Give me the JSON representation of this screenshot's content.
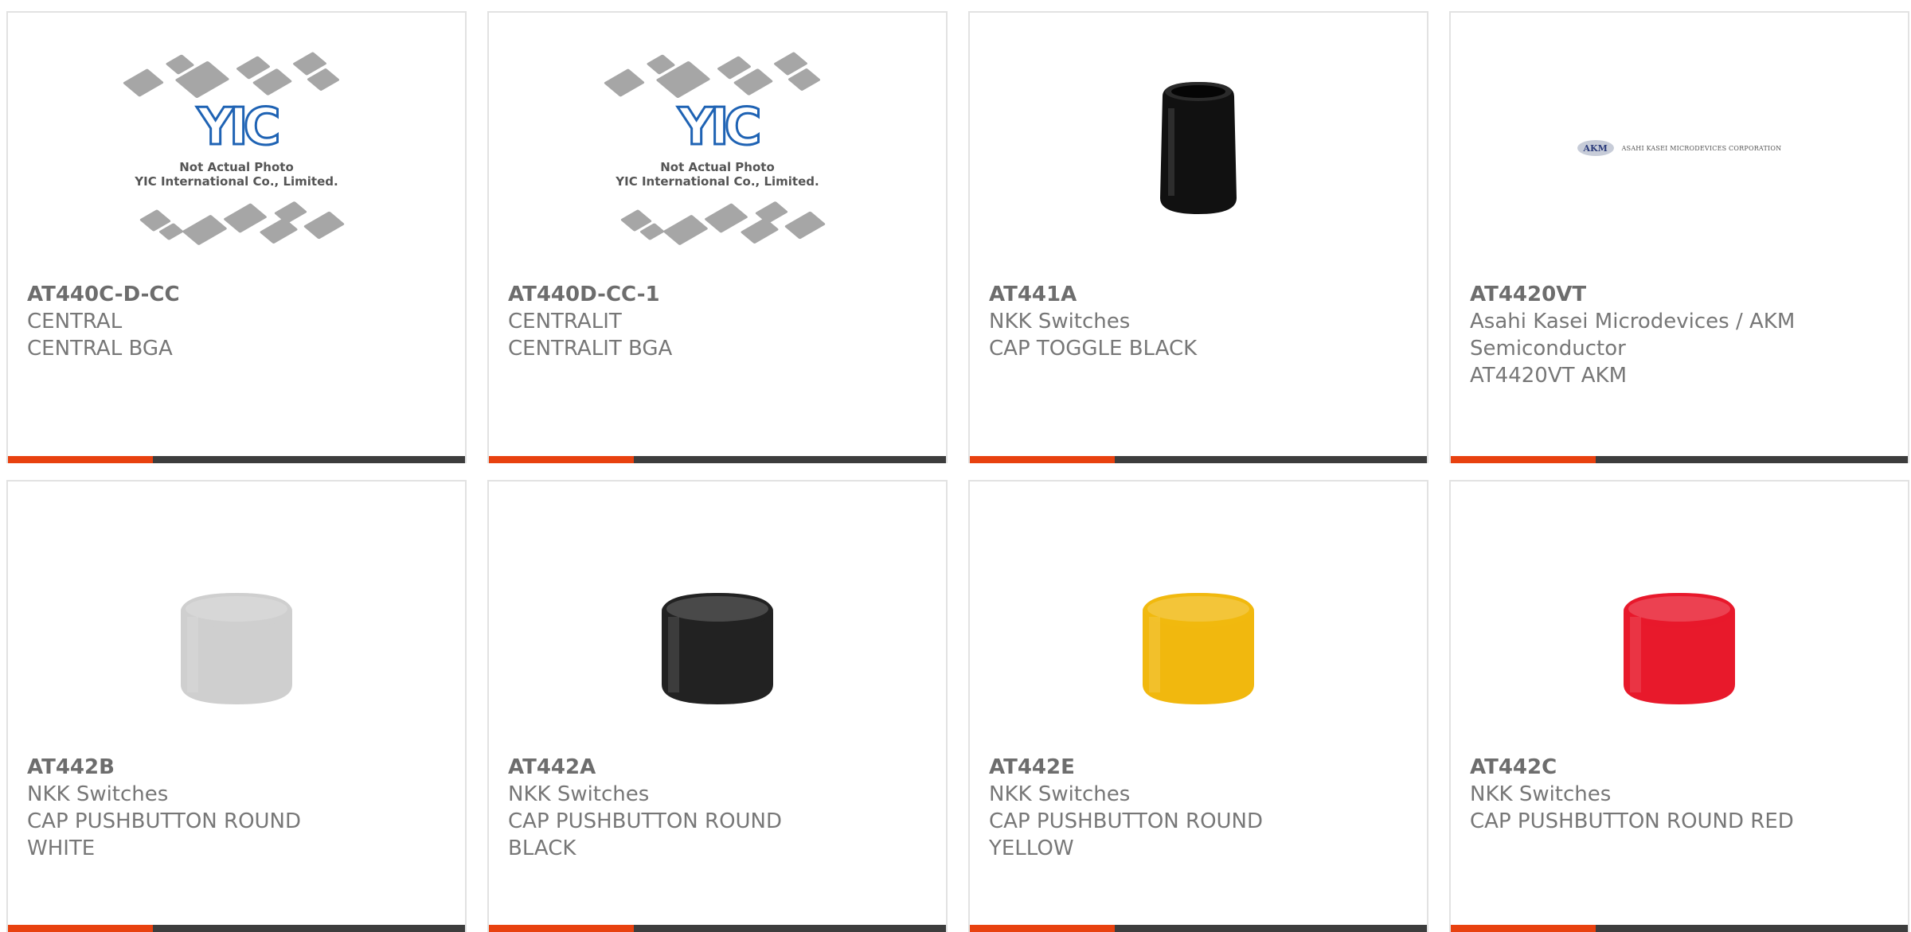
{
  "products": [
    {
      "part": "AT440C-D-CC",
      "lines": [
        "CENTRAL",
        "CENTRAL BGA"
      ],
      "image": "yic-placeholder"
    },
    {
      "part": "AT440D-CC-1",
      "lines": [
        "CENTRALIT",
        "CENTRALIT BGA"
      ],
      "image": "yic-placeholder"
    },
    {
      "part": "AT441A",
      "lines": [
        "NKK Switches",
        "CAP TOGGLE BLACK"
      ],
      "image": "toggle-cap-black"
    },
    {
      "part": "AT4420VT",
      "lines": [
        "Asahi Kasei Microdevices / AKM",
        "Semiconductor",
        "AT4420VT AKM"
      ],
      "image": "akm-logo"
    },
    {
      "part": "AT442B",
      "lines": [
        "NKK Switches",
        "CAP PUSHBUTTON ROUND",
        "WHITE"
      ],
      "image": "pushbutton-cap",
      "cap_color": "#cfcfcf"
    },
    {
      "part": "AT442A",
      "lines": [
        "NKK Switches",
        "CAP PUSHBUTTON ROUND",
        "BLACK"
      ],
      "image": "pushbutton-cap",
      "cap_color": "#222222"
    },
    {
      "part": "AT442E",
      "lines": [
        "NKK Switches",
        "CAP PUSHBUTTON ROUND",
        "YELLOW"
      ],
      "image": "pushbutton-cap",
      "cap_color": "#f1b80e"
    },
    {
      "part": "AT442C",
      "lines": [
        "NKK Switches",
        "CAP PUSHBUTTON ROUND RED"
      ],
      "image": "pushbutton-cap",
      "cap_color": "#e8192b"
    }
  ],
  "placeholder": {
    "line1": "Not Actual Photo",
    "line2": "YIC International Co., Limited.",
    "logo": "YIC"
  },
  "akm": {
    "badge": "AKM",
    "company": "ASAHI KASEI MICRODEVICES CORPORATION"
  },
  "colors": {
    "accent": "#e8410f",
    "bar": "#3d3d3d",
    "border": "#e2e2e2",
    "text": "#777777"
  }
}
